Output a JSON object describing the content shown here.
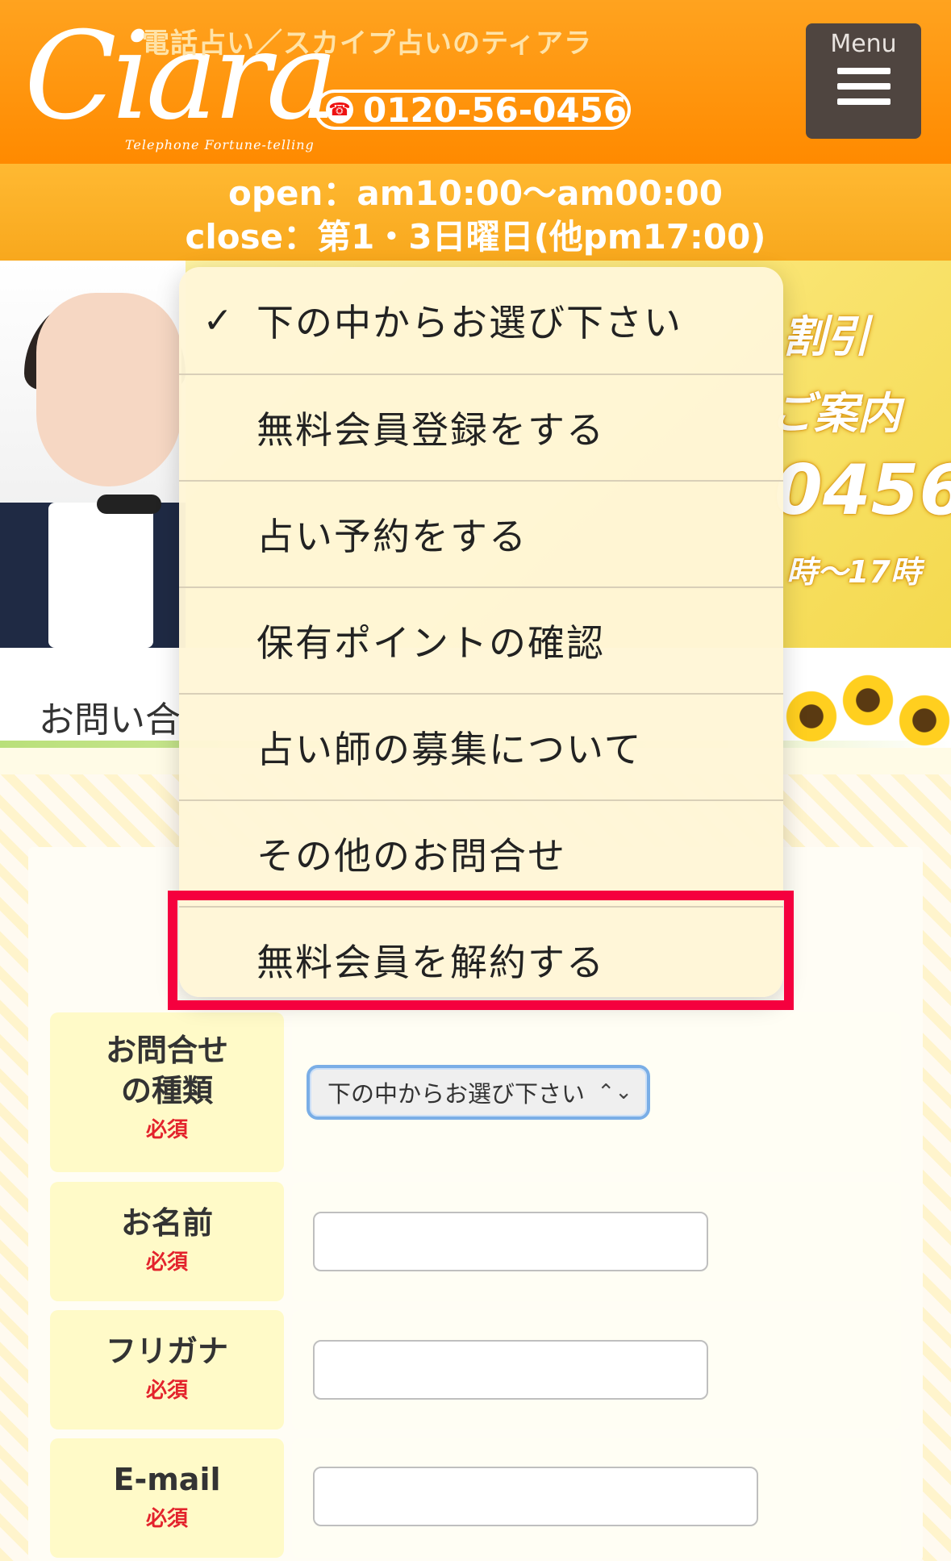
{
  "header": {
    "logo_text": "Ciara",
    "logo_sub": "Telephone  Fortune-telling",
    "tagline": "電話占い／スカイプ占いのティアラ",
    "phone": "0120-56-0456",
    "menu_label": "Menu"
  },
  "hours": {
    "open": "open：am10:00〜am00:00",
    "close": "close：第1・3日曜日(他pm17:00)"
  },
  "banner": {
    "line1": "割引",
    "line2": "ご案内",
    "line3": "0456",
    "line4": "時〜17時"
  },
  "section": {
    "title": "お問い合"
  },
  "form": {
    "rows": [
      {
        "label_line1": "お問合せ",
        "label_line2": "の種類",
        "required": "必須"
      },
      {
        "label": "お名前",
        "required": "必須"
      },
      {
        "label": "フリガナ",
        "required": "必須"
      },
      {
        "label": "E-mail",
        "required": "必須"
      }
    ],
    "select_value": "下の中からお選び下さい"
  },
  "dropdown": {
    "options": [
      {
        "label": "下の中からお選び下さい",
        "selected": true
      },
      {
        "label": "無料会員登録をする"
      },
      {
        "label": "占い予約をする"
      },
      {
        "label": "保有ポイントの確認"
      },
      {
        "label": "占い師の募集について"
      },
      {
        "label": "その他のお問合せ"
      },
      {
        "label": "無料会員を解約する"
      }
    ],
    "check_mark": "✓"
  },
  "colors": {
    "header": "#ff9612",
    "menu_button": "#4f4540",
    "required": "#e3232c",
    "highlight": "#f5003e",
    "select_border": "#7aaee6"
  }
}
